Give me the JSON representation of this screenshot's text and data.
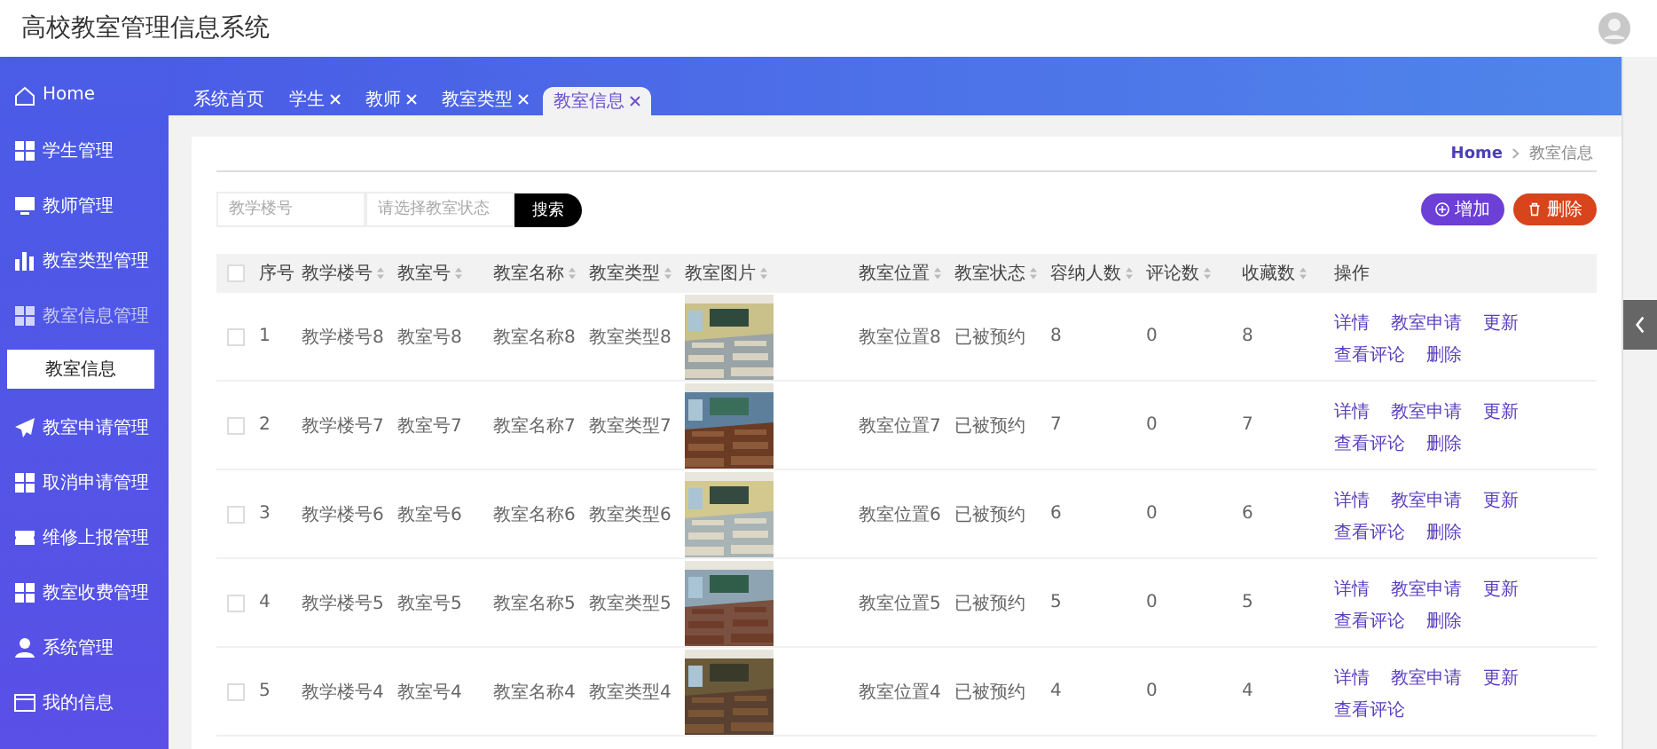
{
  "header": {
    "title": "高校教室管理信息系统"
  },
  "sidebar": {
    "items": [
      {
        "label": "Home",
        "expanded": false
      },
      {
        "label": "学生管理",
        "expanded": false
      },
      {
        "label": "教师管理",
        "expanded": false
      },
      {
        "label": "教室类型管理",
        "expanded": false
      },
      {
        "label": "教室信息管理",
        "expanded": true,
        "children": [
          {
            "label": "教室信息",
            "selected": true
          }
        ]
      },
      {
        "label": "教室申请管理",
        "expanded": false
      },
      {
        "label": "取消申请管理",
        "expanded": false
      },
      {
        "label": "维修上报管理",
        "expanded": false
      },
      {
        "label": "教室收费管理",
        "expanded": false
      },
      {
        "label": "系统管理",
        "expanded": false
      },
      {
        "label": "我的信息",
        "expanded": false
      }
    ]
  },
  "tabs": [
    {
      "label": "系统首页",
      "closable": false,
      "selected": false
    },
    {
      "label": "学生",
      "closable": true,
      "selected": false
    },
    {
      "label": "教师",
      "closable": true,
      "selected": false
    },
    {
      "label": "教室类型",
      "closable": true,
      "selected": false
    },
    {
      "label": "教室信息",
      "closable": true,
      "selected": true
    }
  ],
  "breadcrumb": [
    "Home",
    "教室信息"
  ],
  "search": {
    "building_placeholder": "教学楼号",
    "status_placeholder": "请选择教室状态",
    "button": "搜索"
  },
  "actions": [
    {
      "label": "增加",
      "kind": "add"
    },
    {
      "label": "删除",
      "kind": "delete"
    }
  ],
  "table": {
    "all_checked": false,
    "columns": [
      {
        "label": "序号",
        "sortable": false
      },
      {
        "label": "教学楼号",
        "sortable": true
      },
      {
        "label": "教室号",
        "sortable": true
      },
      {
        "label": "教室名称",
        "sortable": true
      },
      {
        "label": "教室类型",
        "sortable": true
      },
      {
        "label": "教室图片",
        "sortable": true
      },
      {
        "label": "教室位置",
        "sortable": true
      },
      {
        "label": "教室状态",
        "sortable": true
      },
      {
        "label": "容纳人数",
        "sortable": true
      },
      {
        "label": "评论数",
        "sortable": true
      },
      {
        "label": "收藏数",
        "sortable": true
      },
      {
        "label": "操作",
        "sortable": false
      }
    ],
    "rows": [
      {
        "checked": false,
        "cells": [
          "1",
          "教学楼号8",
          "教室号8",
          "教室名称8",
          "教室类型8",
          {
            "kind": "picture"
          },
          "教室位置8",
          "已被预约",
          "8",
          "0",
          "8"
        ],
        "ops": [
          "详情",
          "教室申请",
          "更新",
          "查看评论",
          "删除"
        ]
      },
      {
        "checked": false,
        "cells": [
          "2",
          "教学楼号7",
          "教室号7",
          "教室名称7",
          "教室类型7",
          {
            "kind": "picture"
          },
          "教室位置7",
          "已被预约",
          "7",
          "0",
          "7"
        ],
        "ops": [
          "详情",
          "教室申请",
          "更新",
          "查看评论",
          "删除"
        ]
      },
      {
        "checked": false,
        "cells": [
          "3",
          "教学楼号6",
          "教室号6",
          "教室名称6",
          "教室类型6",
          {
            "kind": "picture"
          },
          "教室位置6",
          "已被预约",
          "6",
          "0",
          "6"
        ],
        "ops": [
          "详情",
          "教室申请",
          "更新",
          "查看评论",
          "删除"
        ]
      },
      {
        "checked": false,
        "cells": [
          "4",
          "教学楼号5",
          "教室号5",
          "教室名称5",
          "教室类型5",
          {
            "kind": "picture"
          },
          "教室位置5",
          "已被预约",
          "5",
          "0",
          "5"
        ],
        "ops": [
          "详情",
          "教室申请",
          "更新",
          "查看评论",
          "删除"
        ]
      },
      {
        "checked": false,
        "cells": [
          "5",
          "教学楼号4",
          "教室号4",
          "教室名称4",
          "教室类型4",
          {
            "kind": "picture"
          },
          "教室位置4",
          "已被预约",
          "4",
          "0",
          "4"
        ],
        "ops": [
          "详情",
          "教室申请",
          "更新",
          "查看评论"
        ]
      }
    ]
  }
}
